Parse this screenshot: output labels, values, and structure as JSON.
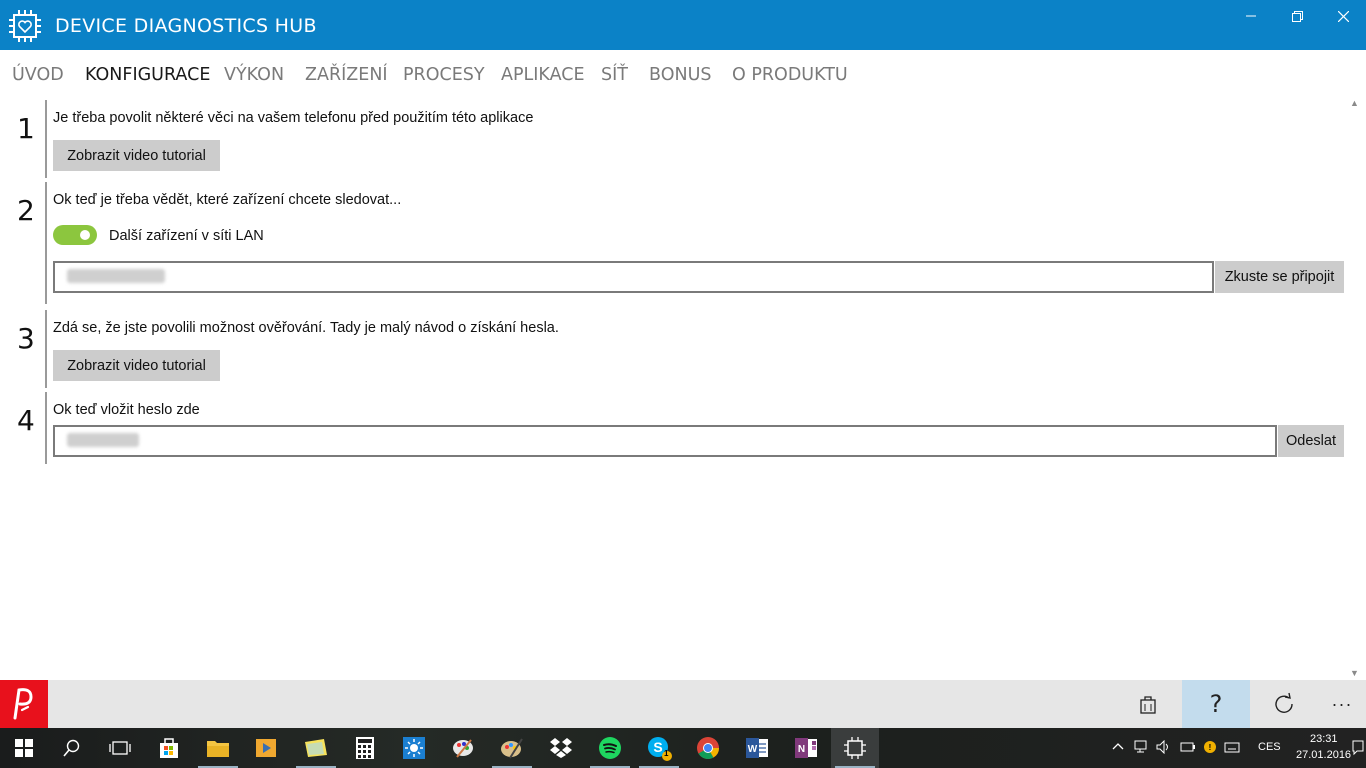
{
  "window": {
    "title": "DEVICE DIAGNOSTICS HUB",
    "controls": [
      "minimize",
      "maximize",
      "close"
    ]
  },
  "nav": {
    "items": [
      {
        "label": "ÚVOD",
        "active": false
      },
      {
        "label": "KONFIGURACE",
        "active": true
      },
      {
        "label": "VÝKON",
        "active": false
      },
      {
        "label": "ZAŘÍZENÍ",
        "active": false
      },
      {
        "label": "PROCESY",
        "active": false
      },
      {
        "label": "APLIKACE",
        "active": false
      },
      {
        "label": "SÍŤ",
        "active": false
      },
      {
        "label": "BONUS",
        "active": false
      },
      {
        "label": "O PRODUKTU",
        "active": false
      }
    ]
  },
  "steps": {
    "s1": {
      "number": "1",
      "text": "Je třeba povolit některé věci na vašem telefonu před použitím této aplikace",
      "button": "Zobrazit video tutorial"
    },
    "s2": {
      "number": "2",
      "text": "Ok teď je třeba vědět, které zařízení chcete sledovat...",
      "toggle_label": "Další zařízení v síti LAN",
      "toggle_on": true,
      "input_value": "",
      "button": "Zkuste se připojit"
    },
    "s3": {
      "number": "3",
      "text": "Zdá se, že jste povolili možnost ověřování. Tady je malý návod o získání hesla.",
      "button": "Zobrazit video tutorial"
    },
    "s4": {
      "number": "4",
      "text": "Ok teď vložit heslo zde",
      "input_value": "",
      "button": "Odeslat"
    }
  },
  "appbar": {
    "buttons": [
      "store-icon",
      "help-icon",
      "refresh-icon",
      "more-icon"
    ],
    "help_label": "?",
    "more_label": "···"
  },
  "taskbar": {
    "apps": [
      "start",
      "search",
      "task-view",
      "store",
      "file-explorer",
      "media-player",
      "sticky-notes",
      "calculator",
      "weather",
      "paint",
      "fresh-paint",
      "dropbox",
      "spotify",
      "skype",
      "chrome",
      "word",
      "onenote",
      "device-diagnostics-hub"
    ],
    "skype_badge": "1",
    "language": "CES",
    "time": "23:31",
    "date": "27.01.2016"
  },
  "colors": {
    "titlebar": "#0b82c7",
    "toggle_on": "#8cc63e",
    "button_gray": "#cccccc",
    "appbar": "#e6e6e6",
    "appbar_highlight": "#c3dced",
    "ad_logo": "#e8111c"
  }
}
